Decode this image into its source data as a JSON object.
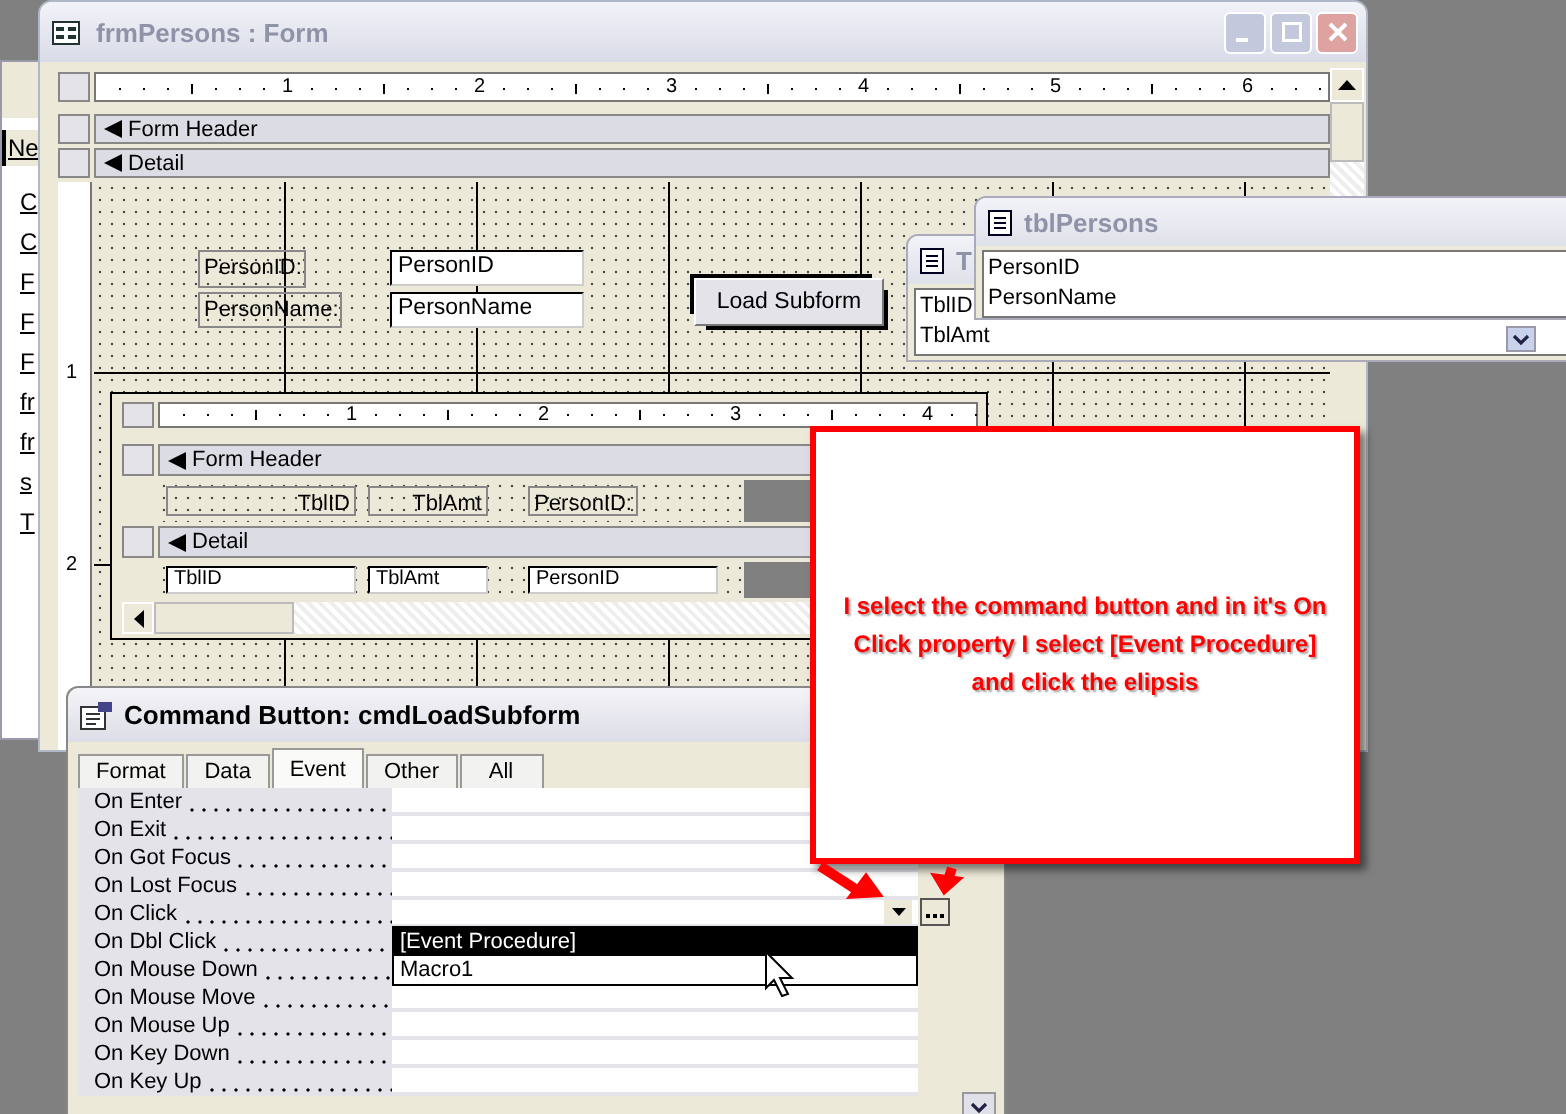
{
  "background_window": {
    "button": "Ne",
    "items": [
      "C",
      "C",
      "F",
      "F",
      "F",
      "fr",
      "fr",
      "s",
      "T"
    ]
  },
  "form_window": {
    "title": "frmPersons : Form",
    "ruler_marks": [
      "1",
      "2",
      "3",
      "4",
      "5",
      "6"
    ],
    "vertical_ruler_marks": [
      "1",
      "2"
    ],
    "sections": [
      "Form Header",
      "Detail"
    ],
    "controls": [
      {
        "kind": "label",
        "text": "PersonID:",
        "selected": false
      },
      {
        "kind": "label",
        "text": "PersonName:",
        "selected": false
      },
      {
        "kind": "textbox",
        "text": "PersonID",
        "selected": false
      },
      {
        "kind": "textbox",
        "text": "PersonName",
        "selected": false
      },
      {
        "kind": "button",
        "text": "Load Subform",
        "selected": true
      }
    ],
    "subform": {
      "ruler_marks": [
        "1",
        "2",
        "3",
        "4"
      ],
      "sections": [
        "Form Header",
        "Detail"
      ],
      "header_labels": [
        "TblID",
        "TblAmt",
        "PersonID:"
      ],
      "detail_fields": [
        "TblID",
        "TblAmt",
        "PersonID"
      ]
    }
  },
  "field_list_back": {
    "title": "T",
    "fields": [
      "TblID",
      "TblAmt"
    ]
  },
  "field_list": {
    "title": "tblPersons",
    "fields": [
      "PersonID",
      "PersonName"
    ]
  },
  "callout": {
    "text": "I select the command button and in it's On Click property I select [Event Procedure] and click the elipsis"
  },
  "property_sheet": {
    "title": "Command Button: cmdLoadSubform",
    "tabs": [
      {
        "label": "Format",
        "selected": false
      },
      {
        "label": "Data",
        "selected": false
      },
      {
        "label": "Event",
        "selected": true
      },
      {
        "label": "Other",
        "selected": false
      },
      {
        "label": "All",
        "selected": false
      }
    ],
    "properties": [
      {
        "name": "On Enter"
      },
      {
        "name": "On Exit"
      },
      {
        "name": "On Got Focus"
      },
      {
        "name": "On Lost Focus"
      },
      {
        "name": "On Click",
        "dropdown": {
          "options": [
            {
              "text": "[Event Procedure]",
              "selected": true
            },
            {
              "text": "Macro1",
              "selected": false
            }
          ]
        }
      },
      {
        "name": "On Dbl Click"
      },
      {
        "name": "On Mouse Down"
      },
      {
        "name": "On Mouse Move"
      },
      {
        "name": "On Mouse Up"
      },
      {
        "name": "On Key Down"
      },
      {
        "name": "On Key Up"
      }
    ]
  }
}
